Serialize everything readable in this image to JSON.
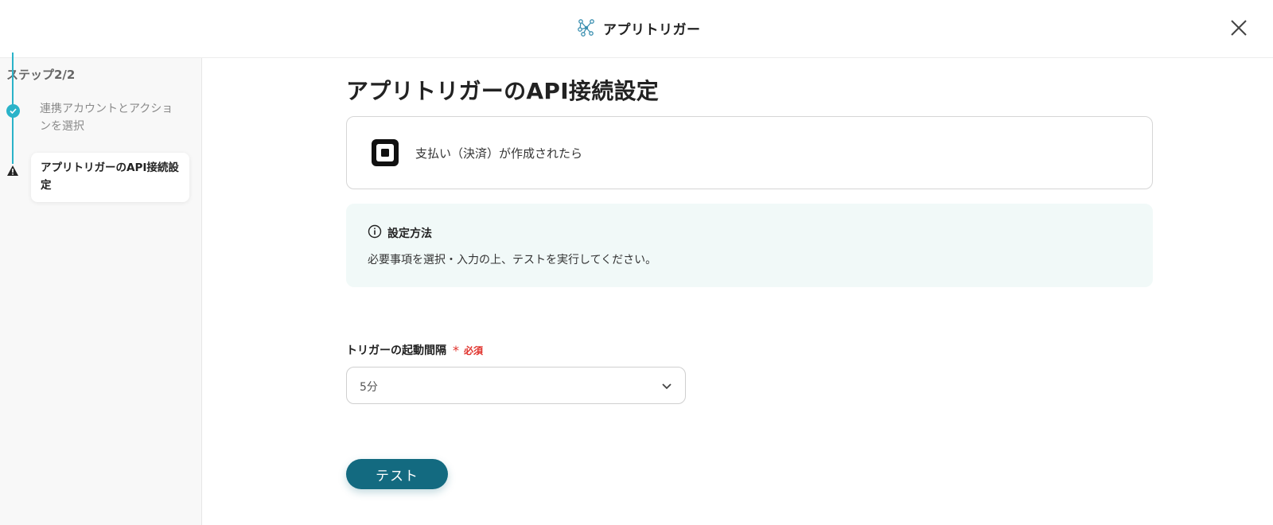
{
  "header": {
    "title": "アプリトリガー",
    "logo_icon": "network-nodes-icon",
    "close_icon": "close-icon"
  },
  "sidebar": {
    "step_count": "ステップ2/2",
    "steps": [
      {
        "label": "連携アカウントとアクションを選択",
        "status": "done",
        "icon": "check-circle-icon"
      },
      {
        "label": "アプリトリガーのAPI接続設定",
        "status": "current-warning",
        "icon": "warning-triangle-icon"
      }
    ]
  },
  "main": {
    "page_title": "アプリトリガーのAPI接続設定",
    "trigger": {
      "app_icon": "square-app-icon",
      "text": "支払い（決済）が作成されたら"
    },
    "info": {
      "icon": "info-icon",
      "title": "設定方法",
      "body": "必要事項を選択・入力の上、テストを実行してください。"
    },
    "interval_field": {
      "label": "トリガーの起動間隔",
      "required_mark": "*",
      "required_text": "必須",
      "selected_value": "5分",
      "dropdown_icon": "chevron-down-icon"
    },
    "test_button": "テスト"
  },
  "colors": {
    "accent": "#2ab3c9",
    "primary_button": "#136a80",
    "info_bg": "#f1f9f8",
    "required": "#e0312b"
  }
}
